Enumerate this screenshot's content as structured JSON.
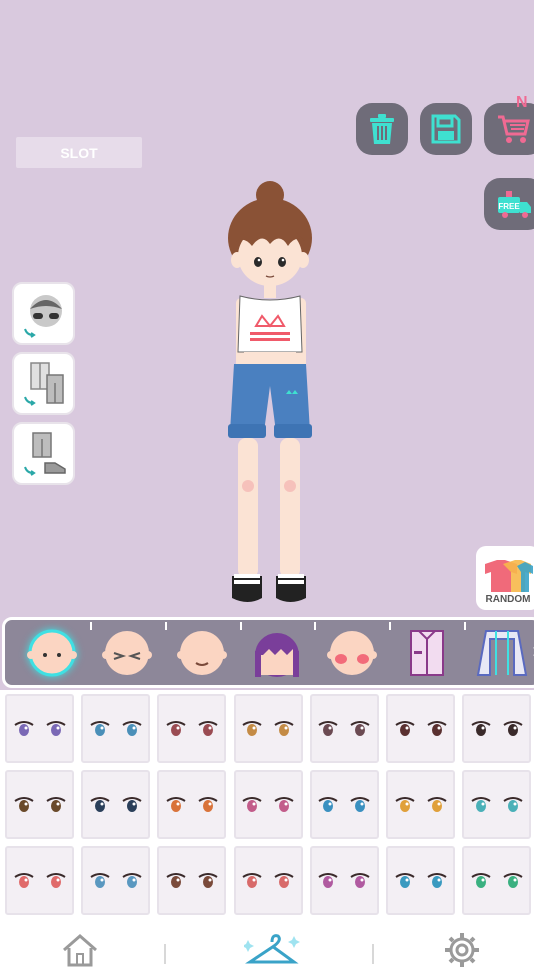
{
  "slot": {
    "label": "SLOT"
  },
  "toolbar": {
    "shop_badge": "N",
    "free_label": "FREE"
  },
  "random": {
    "label": "RANDOM"
  },
  "categories": [
    {
      "icon": "face-base-icon",
      "selected": true
    },
    {
      "icon": "face-closed-eyes-icon",
      "selected": false
    },
    {
      "icon": "face-smile-icon",
      "selected": false
    },
    {
      "icon": "hair-icon",
      "selected": false
    },
    {
      "icon": "blush-icon",
      "selected": false
    },
    {
      "icon": "shirt-icon",
      "selected": false
    },
    {
      "icon": "jacket-icon",
      "selected": false
    }
  ],
  "eye_options": {
    "rows": 3,
    "cols": 7,
    "colors": [
      [
        "#7a68b5",
        "#4a8fb8",
        "#9a4b52",
        "#c48b45",
        "#6b4a52",
        "#5a3030",
        "#3a2a2a"
      ],
      [
        "#6a4a2a",
        "#2a3f5a",
        "#d9733a",
        "#c25c8a",
        "#3a90c0",
        "#e0a03a",
        "#4ab0b8"
      ],
      [
        "#e06a6a",
        "#5a98c0",
        "#7a4a3a",
        "#d86a6a",
        "#b05aa0",
        "#3a9ac0",
        "#3ab080"
      ]
    ]
  },
  "nav": {
    "items": [
      "home-icon",
      "hanger-icon",
      "settings-icon"
    ],
    "active_color": "#3aa3c8"
  }
}
